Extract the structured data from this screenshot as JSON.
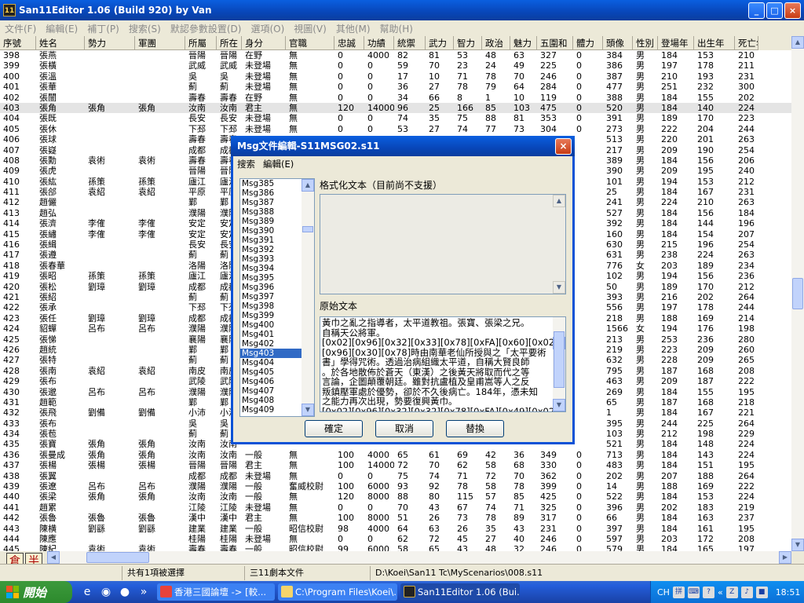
{
  "window": {
    "title": "San11Editor 1.06 (Build 920) by Van",
    "icon": "11",
    "min": "_",
    "max": "□",
    "close": "×"
  },
  "menu": [
    "文件(F)",
    "編輯(E)",
    "補丁(P)",
    "搜索(S)",
    "默認參數設置(D)",
    "選項(O)",
    "視圖(V)",
    "其他(M)",
    "幫助(H)"
  ],
  "columns": [
    "序號",
    "姓名",
    "勢力",
    "軍團",
    "所屬",
    "所在",
    "身分",
    "官職",
    "忠誠",
    "功績",
    "統禦",
    "武力",
    "智力",
    "政治",
    "魅力",
    "五圍和",
    "體力",
    "頭像",
    "性別",
    "登場年",
    "出生年",
    "死亡年"
  ],
  "rows": [
    [
      "398",
      "張燕",
      "",
      "",
      "晉陽",
      "晉陽",
      "在野",
      "無",
      "0",
      "4000",
      "82",
      "81",
      "53",
      "48",
      "63",
      "327",
      "0",
      "384",
      "男",
      "184",
      "153",
      "210"
    ],
    [
      "399",
      "張橫",
      "",
      "",
      "武威",
      "武威",
      "未登場",
      "無",
      "0",
      "0",
      "59",
      "70",
      "23",
      "24",
      "49",
      "225",
      "0",
      "386",
      "男",
      "197",
      "178",
      "211"
    ],
    [
      "400",
      "張溫",
      "",
      "",
      "吳",
      "吳",
      "未登場",
      "無",
      "0",
      "0",
      "17",
      "10",
      "71",
      "78",
      "70",
      "246",
      "0",
      "387",
      "男",
      "210",
      "193",
      "231"
    ],
    [
      "401",
      "張華",
      "",
      "",
      "薊",
      "薊",
      "未登場",
      "無",
      "0",
      "0",
      "36",
      "27",
      "78",
      "79",
      "64",
      "284",
      "0",
      "477",
      "男",
      "251",
      "232",
      "300"
    ],
    [
      "402",
      "張闓",
      "",
      "",
      "壽春",
      "壽春",
      "在野",
      "無",
      "0",
      "0",
      "34",
      "66",
      "8",
      "1",
      "10",
      "119",
      "0",
      "388",
      "男",
      "184",
      "155",
      "202"
    ],
    [
      "403",
      "張角",
      "張角",
      "張角",
      "汝南",
      "汝南",
      "君主",
      "無",
      "120",
      "14000",
      "96",
      "25",
      "166",
      "85",
      "103",
      "475",
      "0",
      "520",
      "男",
      "184",
      "140",
      "224"
    ],
    [
      "404",
      "張既",
      "",
      "",
      "長安",
      "長安",
      "未登場",
      "無",
      "0",
      "0",
      "74",
      "35",
      "75",
      "88",
      "81",
      "353",
      "0",
      "391",
      "男",
      "189",
      "170",
      "223"
    ],
    [
      "405",
      "張休",
      "",
      "",
      "下邳",
      "下邳",
      "未登場",
      "無",
      "0",
      "0",
      "53",
      "27",
      "74",
      "77",
      "73",
      "304",
      "0",
      "273",
      "男",
      "222",
      "204",
      "244"
    ],
    [
      "406",
      "張球",
      "",
      "",
      "壽春",
      "壽春",
      "",
      "",
      "",
      "",
      "",
      "",
      "",
      "",
      "",
      "",
      "",
      "513",
      "男",
      "220",
      "201",
      "263"
    ],
    [
      "407",
      "張嶷",
      "",
      "",
      "成都",
      "成都",
      "",
      "",
      "",
      "",
      "",
      "",
      "",
      "",
      "",
      "",
      "",
      "217",
      "男",
      "209",
      "190",
      "254"
    ],
    [
      "408",
      "張勳",
      "袁術",
      "袁術",
      "壽春",
      "壽春",
      "",
      "",
      "",
      "",
      "",
      "",
      "",
      "",
      "",
      "",
      "",
      "389",
      "男",
      "184",
      "156",
      "206"
    ],
    [
      "409",
      "張虎",
      "",
      "",
      "晉陽",
      "晉陽",
      "",
      "",
      "",
      "",
      "",
      "",
      "",
      "",
      "",
      "",
      "",
      "390",
      "男",
      "209",
      "195",
      "240"
    ],
    [
      "410",
      "張紘",
      "孫策",
      "孫策",
      "廬江",
      "廬江",
      "",
      "",
      "",
      "",
      "",
      "",
      "",
      "",
      "",
      "",
      "",
      "101",
      "男",
      "194",
      "153",
      "212"
    ],
    [
      "411",
      "張郃",
      "袁紹",
      "袁紹",
      "平原",
      "平原",
      "",
      "",
      "",
      "",
      "",
      "",
      "",
      "",
      "",
      "",
      "",
      "25",
      "男",
      "184",
      "167",
      "231"
    ],
    [
      "412",
      "趙儼",
      "",
      "",
      "鄴",
      "鄴",
      "",
      "",
      "",
      "",
      "",
      "",
      "",
      "",
      "",
      "",
      "",
      "241",
      "男",
      "224",
      "210",
      "263"
    ],
    [
      "413",
      "趙弘",
      "",
      "",
      "濮陽",
      "濮陽",
      "",
      "",
      "",
      "",
      "",
      "",
      "",
      "",
      "",
      "",
      "",
      "527",
      "男",
      "184",
      "156",
      "184"
    ],
    [
      "414",
      "張濟",
      "李傕",
      "李傕",
      "安定",
      "安定",
      "",
      "",
      "",
      "",
      "",
      "",
      "",
      "",
      "",
      "",
      "",
      "392",
      "男",
      "184",
      "144",
      "196"
    ],
    [
      "415",
      "張繡",
      "李傕",
      "李傕",
      "安定",
      "安定",
      "",
      "",
      "",
      "",
      "",
      "",
      "",
      "",
      "",
      "",
      "",
      "160",
      "男",
      "184",
      "154",
      "207"
    ],
    [
      "416",
      "張緝",
      "",
      "",
      "長安",
      "長安",
      "",
      "",
      "",
      "",
      "",
      "",
      "",
      "",
      "",
      "",
      "",
      "630",
      "男",
      "215",
      "196",
      "254"
    ],
    [
      "417",
      "張遵",
      "",
      "",
      "薊",
      "薊",
      "",
      "",
      "",
      "",
      "",
      "",
      "",
      "",
      "",
      "",
      "",
      "631",
      "男",
      "238",
      "224",
      "263"
    ],
    [
      "418",
      "張春華",
      "",
      "",
      "洛陽",
      "洛陽",
      "",
      "",
      "",
      "",
      "",
      "",
      "",
      "",
      "",
      "",
      "",
      "776",
      "女",
      "203",
      "189",
      "234"
    ],
    [
      "419",
      "張昭",
      "孫策",
      "孫策",
      "廬江",
      "廬江",
      "",
      "",
      "",
      "",
      "",
      "",
      "",
      "",
      "",
      "",
      "",
      "102",
      "男",
      "194",
      "156",
      "236"
    ],
    [
      "420",
      "張松",
      "劉璋",
      "劉璋",
      "成都",
      "成都",
      "",
      "",
      "",
      "",
      "",
      "",
      "",
      "",
      "",
      "",
      "",
      "50",
      "男",
      "189",
      "170",
      "212"
    ],
    [
      "421",
      "張紹",
      "",
      "",
      "薊",
      "薊",
      "",
      "",
      "",
      "",
      "",
      "",
      "",
      "",
      "",
      "",
      "",
      "393",
      "男",
      "216",
      "202",
      "264"
    ],
    [
      "422",
      "張承",
      "",
      "",
      "下邳",
      "下邳",
      "",
      "",
      "",
      "",
      "",
      "",
      "",
      "",
      "",
      "",
      "",
      "556",
      "男",
      "197",
      "178",
      "244"
    ],
    [
      "423",
      "張任",
      "劉璋",
      "劉璋",
      "成都",
      "成都",
      "",
      "",
      "",
      "",
      "",
      "",
      "",
      "",
      "",
      "",
      "",
      "218",
      "男",
      "188",
      "169",
      "214"
    ],
    [
      "424",
      "貂蟬",
      "呂布",
      "呂布",
      "濮陽",
      "濮陽",
      "",
      "",
      "",
      "",
      "",
      "",
      "",
      "",
      "",
      "",
      "",
      "1566",
      "女",
      "194",
      "176",
      "198"
    ],
    [
      "425",
      "張悌",
      "",
      "",
      "襄陽",
      "襄陽",
      "",
      "",
      "",
      "",
      "",
      "",
      "",
      "",
      "",
      "",
      "",
      "213",
      "男",
      "253",
      "236",
      "280"
    ],
    [
      "426",
      "趙統",
      "",
      "",
      "鄴",
      "鄴",
      "",
      "",
      "",
      "",
      "",
      "",
      "",
      "",
      "",
      "",
      "",
      "219",
      "男",
      "223",
      "209",
      "260"
    ],
    [
      "427",
      "張特",
      "",
      "",
      "薊",
      "薊",
      "",
      "",
      "",
      "",
      "",
      "",
      "",
      "",
      "",
      "",
      "",
      "632",
      "男",
      "228",
      "209",
      "265"
    ],
    [
      "428",
      "張南",
      "袁紹",
      "袁紹",
      "南皮",
      "南皮",
      "",
      "",
      "",
      "",
      "",
      "",
      "",
      "",
      "",
      "",
      "",
      "795",
      "男",
      "187",
      "168",
      "208"
    ],
    [
      "429",
      "張布",
      "",
      "",
      "武陵",
      "武陵",
      "",
      "",
      "",
      "",
      "",
      "",
      "",
      "",
      "",
      "",
      "",
      "463",
      "男",
      "209",
      "187",
      "222"
    ],
    [
      "430",
      "張邈",
      "呂布",
      "呂布",
      "濮陽",
      "濮陽",
      "",
      "",
      "",
      "",
      "",
      "",
      "",
      "",
      "",
      "",
      "",
      "269",
      "男",
      "184",
      "155",
      "195"
    ],
    [
      "431",
      "趙範",
      "",
      "",
      "鄴",
      "鄴",
      "",
      "",
      "",
      "",
      "",
      "",
      "",
      "",
      "",
      "",
      "",
      "65",
      "男",
      "187",
      "168",
      "218"
    ],
    [
      "432",
      "張飛",
      "劉備",
      "劉備",
      "小沛",
      "小沛",
      "",
      "",
      "",
      "",
      "",
      "",
      "",
      "",
      "",
      "",
      "",
      "1",
      "男",
      "184",
      "167",
      "221"
    ],
    [
      "433",
      "張布",
      "",
      "",
      "吳",
      "吳",
      "",
      "",
      "",
      "",
      "",
      "",
      "",
      "",
      "",
      "",
      "",
      "395",
      "男",
      "244",
      "225",
      "264"
    ],
    [
      "434",
      "張苞",
      "",
      "",
      "薊",
      "薊",
      "",
      "",
      "",
      "",
      "",
      "",
      "",
      "",
      "",
      "",
      "",
      "103",
      "男",
      "212",
      "198",
      "229"
    ],
    [
      "435",
      "張寶",
      "張角",
      "張角",
      "汝南",
      "汝南",
      "",
      "",
      "",
      "",
      "",
      "",
      "",
      "",
      "",
      "",
      "",
      "521",
      "男",
      "184",
      "148",
      "224"
    ],
    [
      "436",
      "張曼成",
      "張角",
      "張角",
      "汝南",
      "汝南",
      "一般",
      "無",
      "100",
      "4000",
      "65",
      "61",
      "69",
      "42",
      "36",
      "349",
      "0",
      "713",
      "男",
      "184",
      "143",
      "224"
    ],
    [
      "437",
      "張楊",
      "張楊",
      "張楊",
      "晉陽",
      "晉陽",
      "君主",
      "無",
      "100",
      "14000",
      "72",
      "70",
      "62",
      "58",
      "68",
      "330",
      "0",
      "483",
      "男",
      "184",
      "151",
      "195"
    ],
    [
      "438",
      "張翼",
      "",
      "",
      "成都",
      "成都",
      "未登場",
      "無",
      "0",
      "0",
      "75",
      "74",
      "71",
      "72",
      "70",
      "362",
      "0",
      "202",
      "男",
      "207",
      "188",
      "264"
    ],
    [
      "439",
      "張遼",
      "呂布",
      "呂布",
      "濮陽",
      "濮陽",
      "一般",
      "奮威校尉",
      "100",
      "6000",
      "93",
      "92",
      "78",
      "58",
      "78",
      "399",
      "0",
      "14",
      "男",
      "188",
      "169",
      "222"
    ],
    [
      "440",
      "張梁",
      "張角",
      "張角",
      "汝南",
      "汝南",
      "一般",
      "無",
      "120",
      "8000",
      "88",
      "80",
      "115",
      "57",
      "85",
      "425",
      "0",
      "522",
      "男",
      "184",
      "153",
      "224"
    ],
    [
      "441",
      "趙累",
      "",
      "",
      "江陵",
      "江陵",
      "未登場",
      "無",
      "0",
      "0",
      "70",
      "43",
      "67",
      "74",
      "71",
      "325",
      "0",
      "396",
      "男",
      "202",
      "183",
      "219"
    ],
    [
      "442",
      "張魯",
      "張魯",
      "張魯",
      "漢中",
      "漢中",
      "君主",
      "無",
      "100",
      "8000",
      "51",
      "26",
      "73",
      "78",
      "89",
      "317",
      "0",
      "66",
      "男",
      "184",
      "163",
      "237"
    ],
    [
      "443",
      "陳横",
      "劉繇",
      "劉繇",
      "建業",
      "建業",
      "一般",
      "昭信校尉",
      "98",
      "4000",
      "64",
      "63",
      "26",
      "35",
      "43",
      "231",
      "0",
      "397",
      "男",
      "184",
      "161",
      "195"
    ],
    [
      "444",
      "陳應",
      "",
      "",
      "桂陽",
      "桂陽",
      "未登場",
      "無",
      "0",
      "0",
      "62",
      "72",
      "45",
      "27",
      "40",
      "246",
      "0",
      "597",
      "男",
      "203",
      "172",
      "208"
    ],
    [
      "445",
      "陳紀",
      "袁術",
      "袁術",
      "壽春",
      "壽春",
      "一般",
      "昭信校尉",
      "99",
      "6000",
      "58",
      "65",
      "43",
      "48",
      "32",
      "246",
      "0",
      "579",
      "男",
      "184",
      "165",
      "197"
    ],
    [
      "446",
      "陳宮",
      "呂布",
      "呂布",
      "濮陽",
      "濮陽",
      "一般",
      "無",
      "120",
      "6000",
      "58",
      "28",
      "55",
      "83",
      "68",
      "373",
      "0",
      "104",
      "男",
      "184",
      "154",
      "198"
    ]
  ],
  "selected_row_index": 5,
  "ime": {
    "full": "倉",
    "half": "半"
  },
  "status": {
    "selection": "共有1項被選擇",
    "file_type": "三11劇本文件",
    "path": "D:\\Koei\\San11 Tc\\MyScenarios\\008.s11"
  },
  "dialog": {
    "title": "Msg文件編輯-S11MSG02.s11",
    "close": "×",
    "menu": [
      "搜索",
      "編輯(E)"
    ],
    "list_items": [
      "Msg385",
      "Msg386",
      "Msg387",
      "Msg388",
      "Msg389",
      "Msg390",
      "Msg391",
      "Msg392",
      "Msg393",
      "Msg394",
      "Msg395",
      "Msg396",
      "Msg397",
      "Msg398",
      "Msg399",
      "Msg400",
      "Msg401",
      "Msg402",
      "Msg403",
      "Msg404",
      "Msg405",
      "Msg406",
      "Msg407",
      "Msg408",
      "Msg409"
    ],
    "selected_list_index": 18,
    "formatted_label": "格式化文本（目前尚不支援）",
    "raw_label": "原始文本",
    "raw_lines": [
      "黃巾之亂之指導者，太平道教祖。張寶、張梁之兄。",
      "自稱天公將軍。",
      "[0x02][0x96][0x32][0x33][0x78][0xFA][0x60][0x02]",
      "[0x96][0x30][0x78]時由南華老仙所授與之「太平要術",
      "書」學得咒術。透過治病組織太平道，自稱大賢良師",
      "。於各地散佈於蒼天（東漢）之後黃天將取而代之等",
      "言論，企圖顛覆朝廷。雖對抗盧植及皇甫嵩等人之反",
      "叛鎮壓軍處於優勢，卻於不久後病亡。184年，憑未知",
      "之能力再次出現，勢要復興黃巾。",
      "[0x02][0x96][0x32][0x32][0x78][0xFA][0x49][0x02]"
    ],
    "buttons": {
      "ok": "確定",
      "cancel": "取消",
      "replace": "替換"
    }
  },
  "taskbar": {
    "start": "開始",
    "tasks": [
      "香港三國論壇 -> [較...",
      "C:\\Program Files\\Koei\\...",
      "San11Editor 1.06 (Bui..."
    ],
    "tray_lang": "CH",
    "clock": "18:51"
  }
}
